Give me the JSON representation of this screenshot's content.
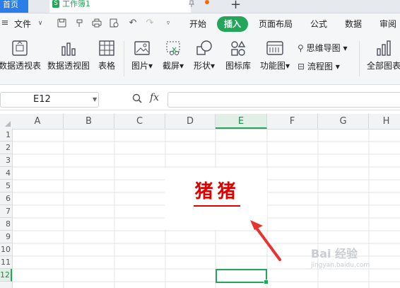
{
  "titlebar": {
    "home_tab": "首页",
    "doc_tab": "工作簿1",
    "doc_icon": "S",
    "new_tab": "+"
  },
  "menu": {
    "file": "文件",
    "items": [
      "开始",
      "插入",
      "页面布局",
      "公式",
      "数据",
      "审阅"
    ],
    "active": "插入"
  },
  "ribbon": {
    "pivot_table": "数据透视表",
    "pivot_chart": "数据透视图",
    "table": "表格",
    "picture": "图片",
    "screenshot": "截屏",
    "shape": "形状",
    "icon_lib": "图标库",
    "function_chart": "功能图",
    "mindmap": "思维导图",
    "flowchart": "流程图",
    "all_charts": "全部图表"
  },
  "formula_bar": {
    "name_box": "E12",
    "fx": "fx",
    "formula": ""
  },
  "sheet": {
    "columns": [
      "A",
      "B",
      "C",
      "D",
      "E",
      "F",
      "G",
      "H"
    ],
    "rows": [
      "1",
      "2",
      "3",
      "4",
      "5",
      "6",
      "7",
      "8",
      "9",
      "10",
      "11",
      "12"
    ],
    "selected_column": "E",
    "selected_row": "12",
    "cell_text": "猪猪"
  },
  "watermark": {
    "text": "Bai 经验",
    "url": "jingyan.baidu.com"
  },
  "colors": {
    "accent": "#23a55a",
    "text_red": "#e00000"
  }
}
